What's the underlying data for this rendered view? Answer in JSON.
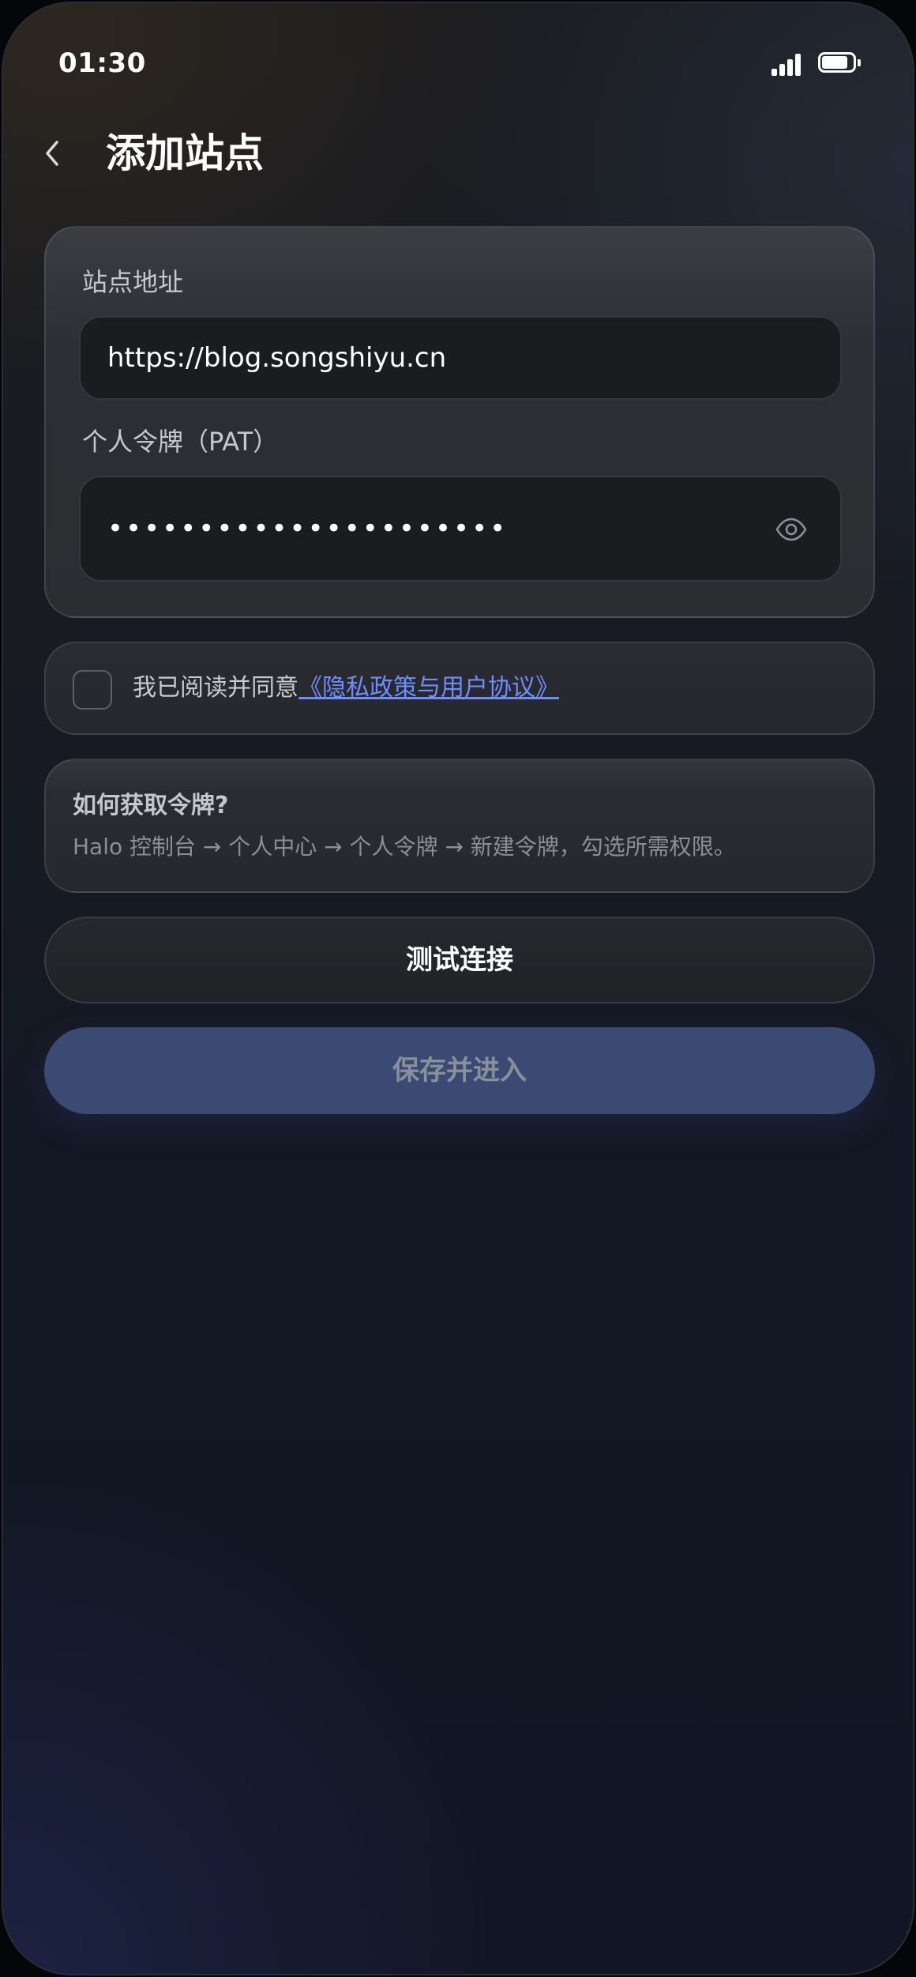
{
  "status_bar": {
    "time": "01:30"
  },
  "header": {
    "title": "添加站点"
  },
  "form": {
    "site_label": "站点地址",
    "site_value": "https://blog.songshiyu.cn",
    "token_label": "个人令牌（PAT）",
    "token_value": "••••••••••••••••••••••"
  },
  "agreement": {
    "prefix": "我已阅读并同意",
    "link_text": "《隐私政策与用户协议》",
    "checked": false
  },
  "help": {
    "title": "如何获取令牌?",
    "body": "Halo 控制台 → 个人中心 → 个人令牌 → 新建令牌，勾选所需权限。"
  },
  "actions": {
    "test_label": "测试连接",
    "save_label": "保存并进入"
  },
  "icons": {
    "back": "chevron-left-icon",
    "eye": "eye-icon",
    "signal": "signal-icon",
    "battery": "battery-icon"
  },
  "colors": {
    "link": "#6f8dff",
    "primary_button": "#3b4a72"
  }
}
